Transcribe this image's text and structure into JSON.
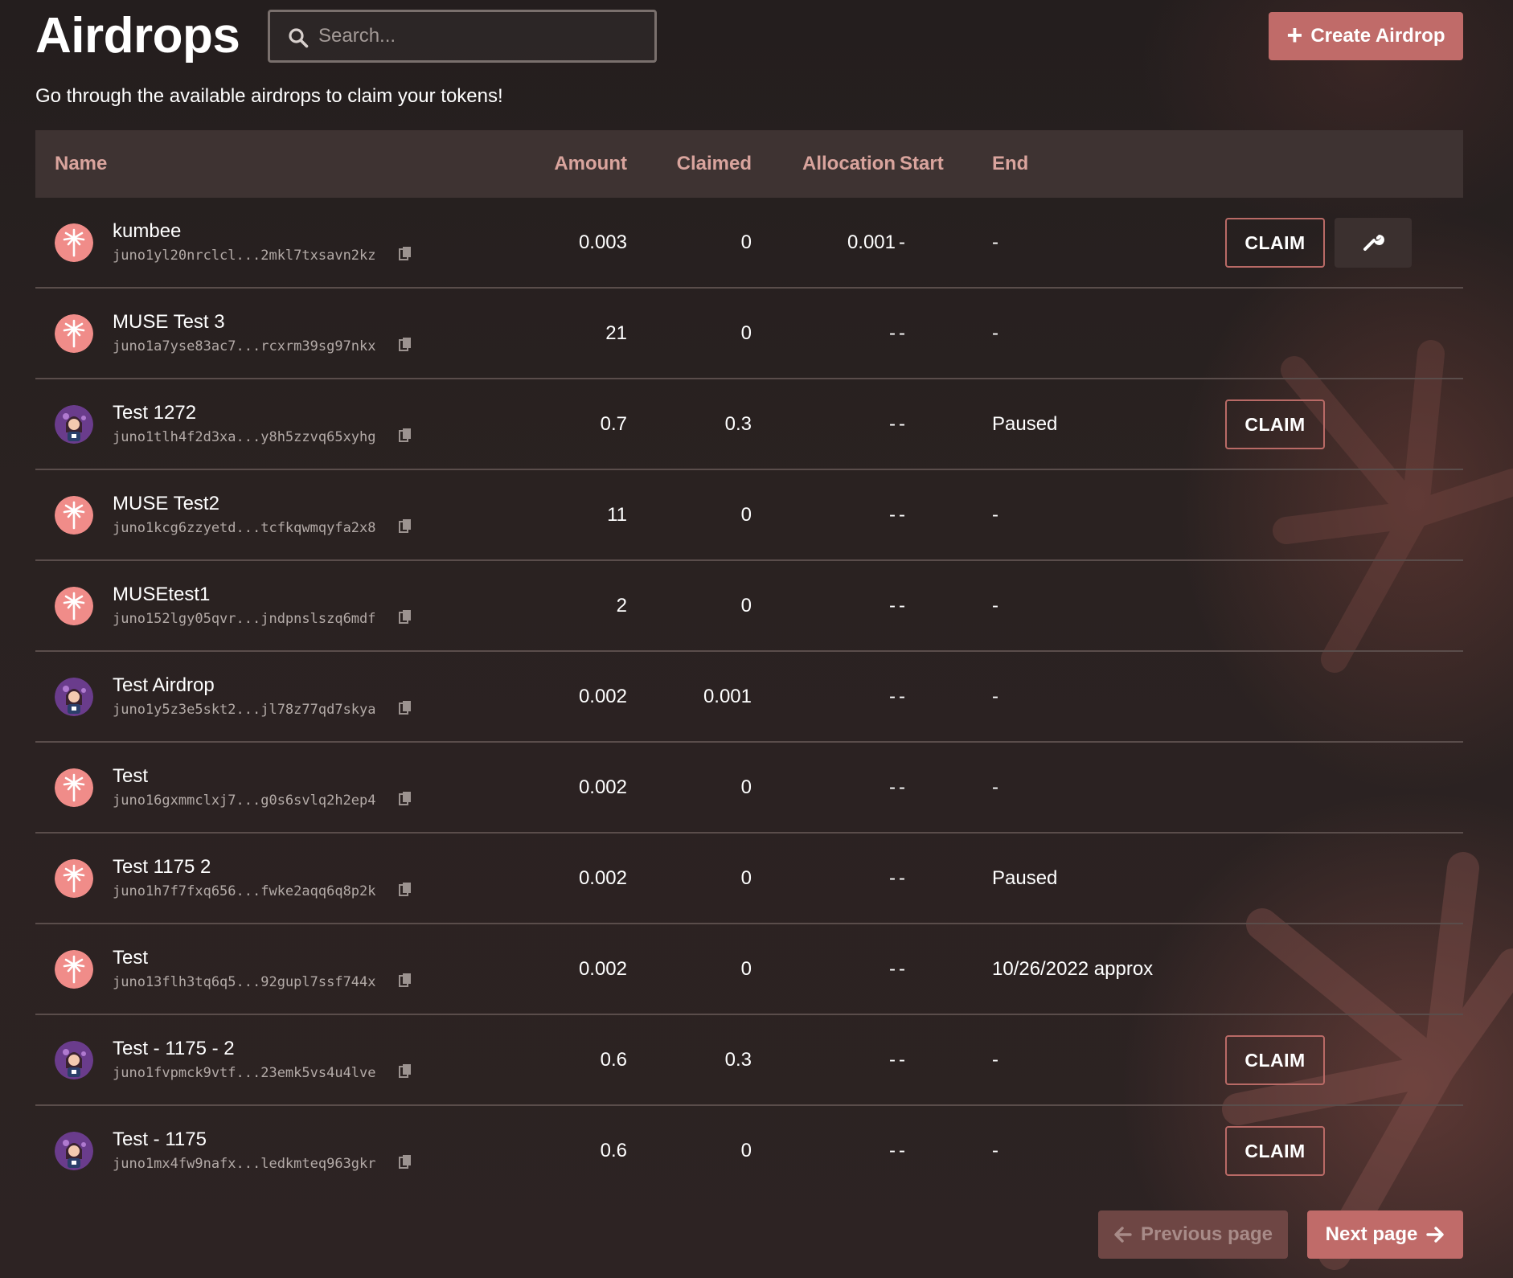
{
  "header": {
    "title": "Airdrops",
    "search_placeholder": "Search...",
    "create_label": "Create Airdrop",
    "subtitle": "Go through the available airdrops to claim your tokens!"
  },
  "table": {
    "columns": [
      "Name",
      "Amount",
      "Claimed",
      "Allocation",
      "Start",
      "End"
    ],
    "claim_label": "CLAIM",
    "rows": [
      {
        "name": "kumbee",
        "address": "juno1yl20nrclcl...2mkl7txsavn2kz",
        "amount": "0.003",
        "claimed": "0",
        "allocation": "0.001",
        "start": "-",
        "end": "-",
        "avatar": "palm-tree-icon",
        "claim": true,
        "edit": true
      },
      {
        "name": "MUSE Test 3",
        "address": "juno1a7yse83ac7...rcxrm39sg97nkx",
        "amount": "21",
        "claimed": "0",
        "allocation": "-",
        "start": "-",
        "end": "-",
        "avatar": "palm-tree-icon",
        "claim": false,
        "edit": false
      },
      {
        "name": "Test 1272",
        "address": "juno1tlh4f2d3xa...y8h5zzvq65xyhg",
        "amount": "0.7",
        "claimed": "0.3",
        "allocation": "-",
        "start": "-",
        "end": "Paused",
        "avatar": "character-avatar",
        "claim": true,
        "edit": false
      },
      {
        "name": "MUSE Test2",
        "address": "juno1kcg6zzyetd...tcfkqwmqyfa2x8",
        "amount": "11",
        "claimed": "0",
        "allocation": "-",
        "start": "-",
        "end": "-",
        "avatar": "palm-tree-icon",
        "claim": false,
        "edit": false
      },
      {
        "name": "MUSEtest1",
        "address": "juno152lgy05qvr...jndpnslszq6mdf",
        "amount": "2",
        "claimed": "0",
        "allocation": "-",
        "start": "-",
        "end": "-",
        "avatar": "palm-tree-icon",
        "claim": false,
        "edit": false
      },
      {
        "name": "Test Airdrop",
        "address": "juno1y5z3e5skt2...jl78z77qd7skya",
        "amount": "0.002",
        "claimed": "0.001",
        "allocation": "-",
        "start": "-",
        "end": "-",
        "avatar": "character-avatar",
        "claim": false,
        "edit": false
      },
      {
        "name": "Test",
        "address": "juno16gxmmclxj7...g0s6svlq2h2ep4",
        "amount": "0.002",
        "claimed": "0",
        "allocation": "-",
        "start": "-",
        "end": "-",
        "avatar": "palm-tree-icon",
        "claim": false,
        "edit": false
      },
      {
        "name": "Test 1175 2",
        "address": "juno1h7f7fxq656...fwke2aqq6q8p2k",
        "amount": "0.002",
        "claimed": "0",
        "allocation": "-",
        "start": "-",
        "end": "Paused",
        "avatar": "palm-tree-icon",
        "claim": false,
        "edit": false
      },
      {
        "name": "Test",
        "address": "juno13flh3tq6q5...92gupl7ssf744x",
        "amount": "0.002",
        "claimed": "0",
        "allocation": "-",
        "start": "-",
        "end": "10/26/2022 approx",
        "avatar": "palm-tree-icon",
        "claim": false,
        "edit": false
      },
      {
        "name": "Test - 1175 - 2",
        "address": "juno1fvpmck9vtf...23emk5vs4u4lve",
        "amount": "0.6",
        "claimed": "0.3",
        "allocation": "-",
        "start": "-",
        "end": "-",
        "avatar": "character-avatar",
        "claim": true,
        "edit": false
      },
      {
        "name": "Test - 1175",
        "address": "juno1mx4fw9nafx...ledkmteq963gkr",
        "amount": "0.6",
        "claimed": "0",
        "allocation": "-",
        "start": "-",
        "end": "-",
        "avatar": "character-avatar",
        "claim": true,
        "edit": false
      }
    ]
  },
  "pager": {
    "prev_label": "Previous page",
    "next_label": "Next page"
  },
  "colors": {
    "accent": "#c06b69",
    "header_row": "#3e3332",
    "header_text": "#d9a49d",
    "background": "#2a2221"
  }
}
